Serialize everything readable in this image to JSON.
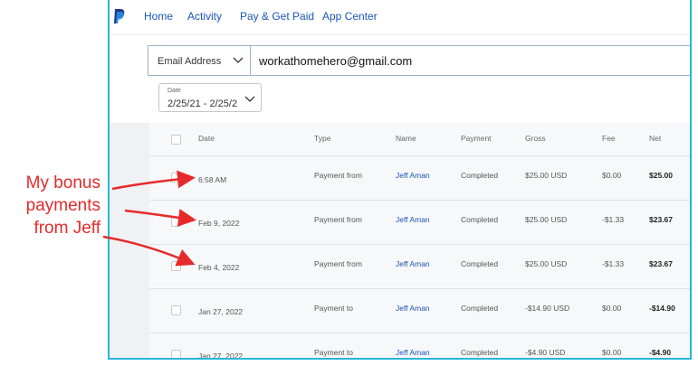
{
  "nav": {
    "items": [
      "Home",
      "Activity",
      "Pay & Get Paid",
      "App Center"
    ]
  },
  "filters": {
    "email_label": "Email Address",
    "email_value": "workathomehero@gmail.com",
    "date_label": "Date",
    "date_value": "2/25/21 - 2/25/2"
  },
  "table": {
    "headers": [
      "Date",
      "Type",
      "Name",
      "Payment",
      "Gross",
      "Fee",
      "Net"
    ],
    "rows": [
      {
        "date": "6:58 AM",
        "type": "Payment from",
        "name": "Jeff Aman",
        "payment": "Completed",
        "gross": "$25.00 USD",
        "fee": "$0.00",
        "net": "$25.00"
      },
      {
        "date": "Feb 9, 2022",
        "type": "Payment from",
        "name": "Jeff Aman",
        "payment": "Completed",
        "gross": "$25.00 USD",
        "fee": "-$1.33",
        "net": "$23.67"
      },
      {
        "date": "Feb 4, 2022",
        "type": "Payment from",
        "name": "Jeff Aman",
        "payment": "Completed",
        "gross": "$25.00 USD",
        "fee": "-$1.33",
        "net": "$23.67"
      },
      {
        "date": "Jan 27, 2022",
        "type": "Payment to",
        "name": "Jeff Aman",
        "payment": "Completed",
        "gross": "-$14.90 USD",
        "fee": "$0.00",
        "net": "-$14.90"
      },
      {
        "date": "Jan 27, 2022",
        "type": "Payment to",
        "name": "Jeff Aman",
        "payment": "Completed",
        "gross": "-$4.90 USD",
        "fee": "$0.00",
        "net": "-$4.90"
      }
    ]
  },
  "annotation": {
    "lines": [
      "My bonus",
      "payments",
      "from Jeff"
    ],
    "color": "#e62a2a"
  },
  "colors": {
    "brand_blue": "#1a56b8",
    "frame_border": "#29b6d8"
  }
}
